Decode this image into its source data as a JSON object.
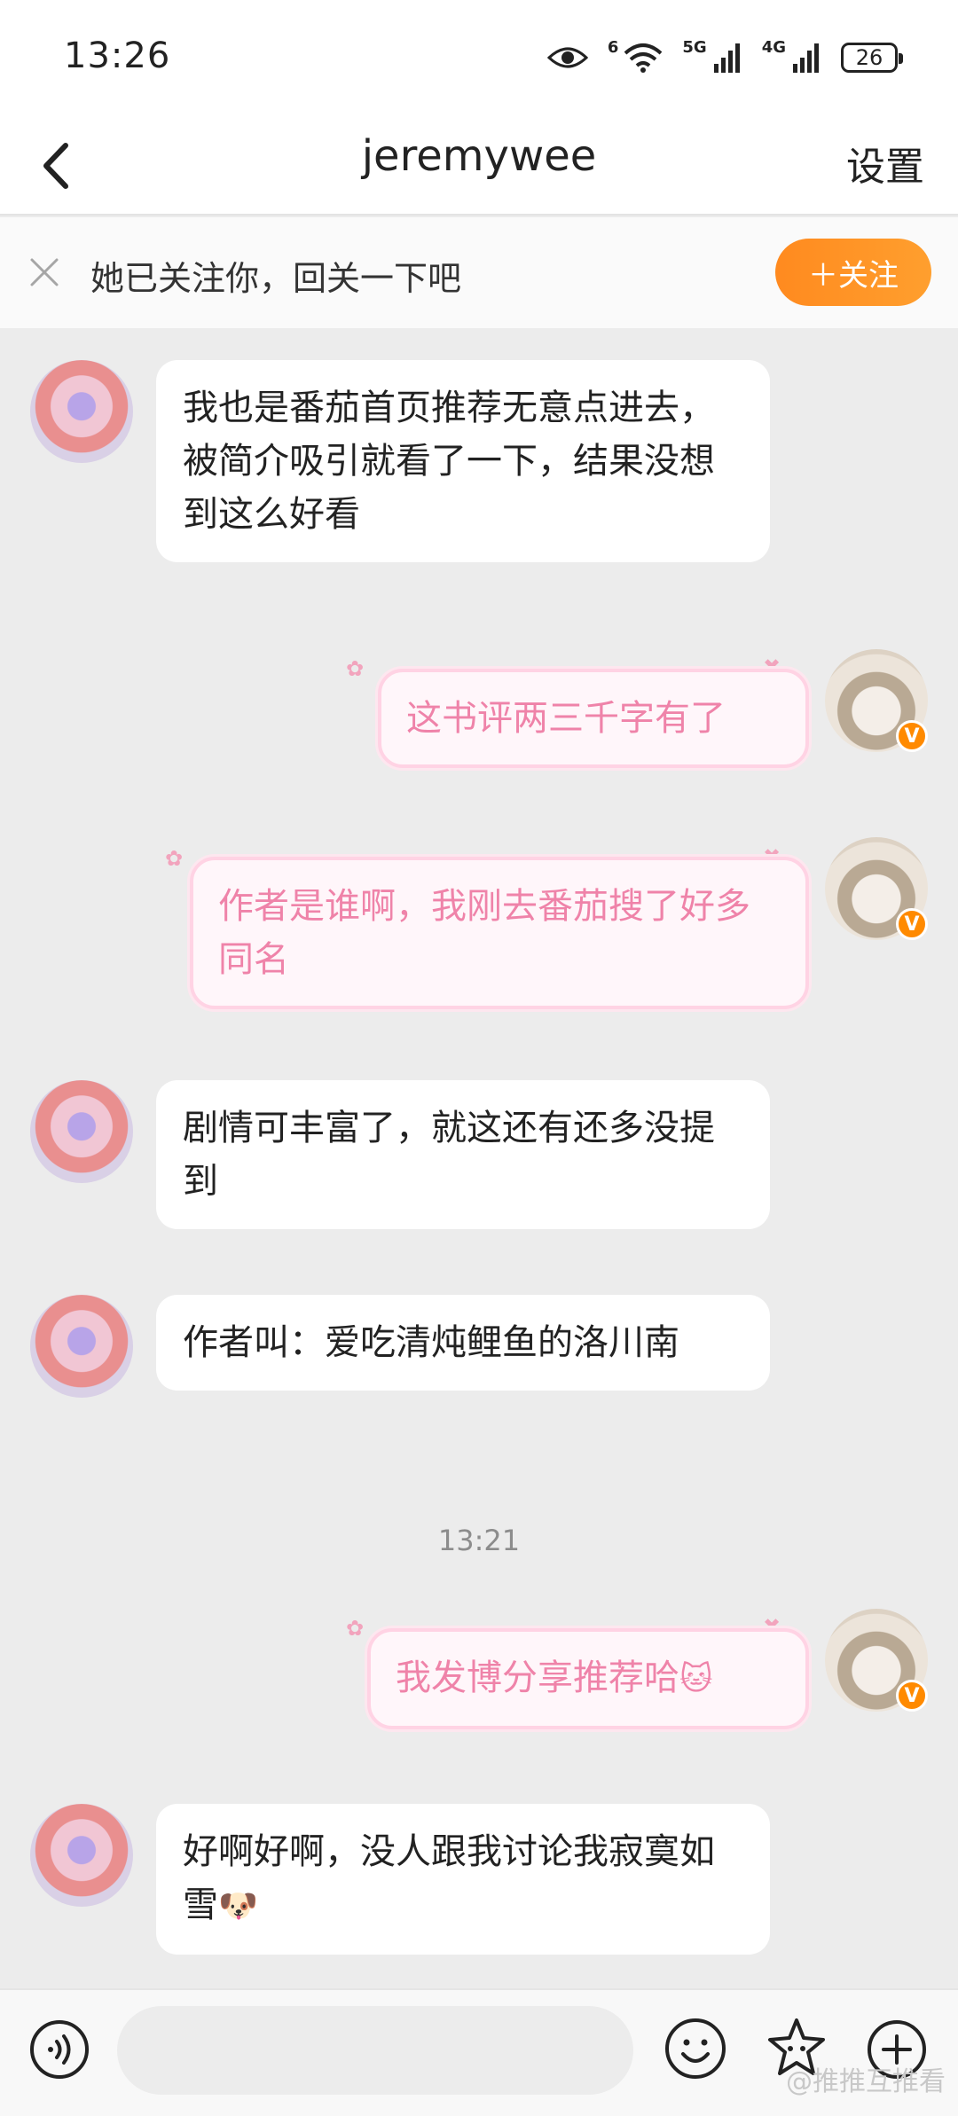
{
  "status_bar": {
    "time": "13:26",
    "battery": "26",
    "net1": "5G",
    "net2": "4G",
    "wifi_tag": "6"
  },
  "nav": {
    "title": "jeremywee",
    "settings_label": "设置"
  },
  "banner": {
    "text": "她已关注你，回关一下吧",
    "follow_label": "＋关注"
  },
  "messages": [
    {
      "side": "left",
      "text": "我也是番茄首页推荐无意点进去，被简介吸引就看了一下，结果没想到这么好看"
    },
    {
      "side": "right",
      "text": "这书评两三千字有了"
    },
    {
      "side": "right",
      "text": "作者是谁啊，我刚去番茄搜了好多同名"
    },
    {
      "side": "left",
      "text": "剧情可丰富了，就这还有还多没提到"
    },
    {
      "side": "left",
      "text": "作者叫：爱吃清炖鲤鱼的洛川南"
    },
    {
      "timestamp": "13:21"
    },
    {
      "side": "right",
      "text": "我发博分享推荐哈",
      "emoji": "🐱"
    },
    {
      "side": "left",
      "text": "好啊好啊，没人跟我讨论我寂寞如雪",
      "emoji": "🐶"
    }
  ],
  "input": {
    "placeholder": ""
  },
  "watermark": "@推推互推看",
  "colors": {
    "accent": "#ff8a1f",
    "bubble_pink_text": "#ef83a9",
    "bubble_pink_border": "#ffd3e4",
    "chat_bg": "#ececec"
  },
  "icons": [
    "back-arrow-icon",
    "eye-icon",
    "wifi-icon",
    "signal-icon",
    "battery-icon",
    "close-icon",
    "voice-icon",
    "emoji-icon",
    "sticker-icon",
    "plus-icon",
    "verified-icon"
  ]
}
